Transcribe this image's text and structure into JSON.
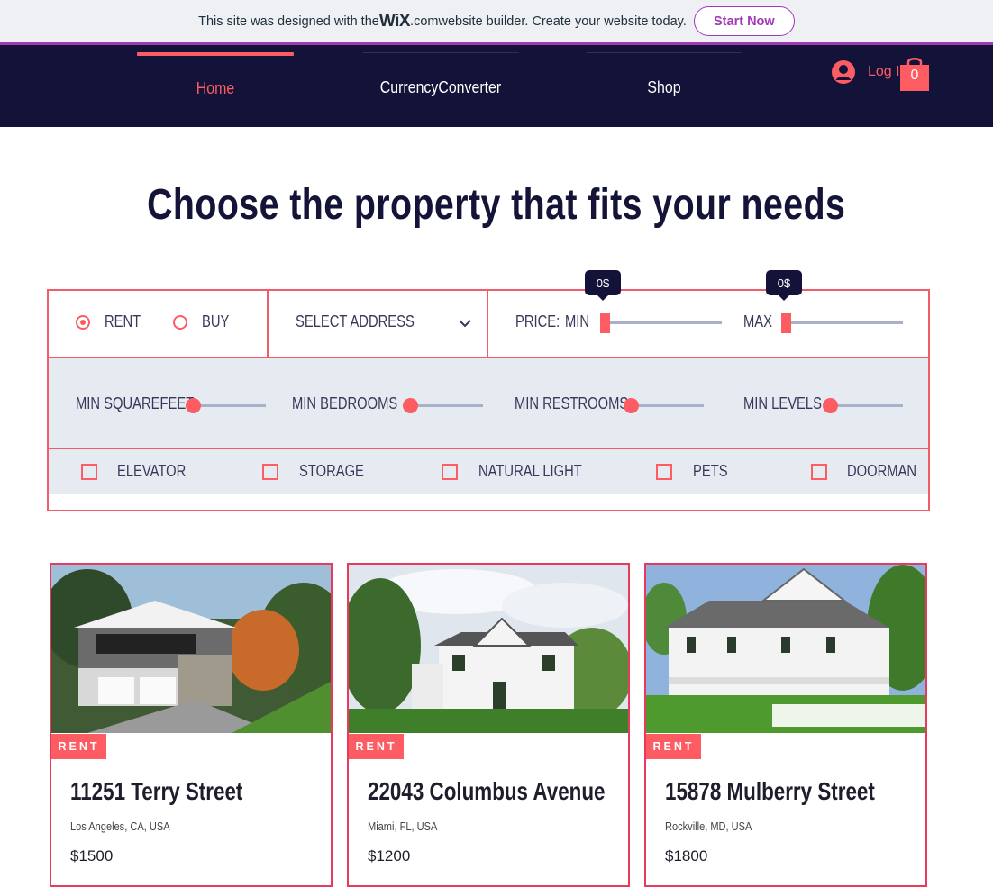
{
  "banner": {
    "text_before": "This site was designed with the ",
    "brand": "WiX",
    "brand_suffix": ".com",
    "text_after": " website builder. Create your website today.",
    "cta": "Start Now"
  },
  "nav": {
    "tabs": [
      "Home",
      "CurrencyConverter",
      "Shop"
    ],
    "active_tab": "Home",
    "login_label": "Log In",
    "cart_count": "0"
  },
  "heading": "Choose the property that fits your needs",
  "filters": {
    "rent_label": "RENT",
    "buy_label": "BUY",
    "selected_mode": "RENT",
    "address_placeholder": "SELECT ADDRESS",
    "price_label": "PRICE:",
    "min_label": "MIN",
    "max_label": "MAX",
    "min_value": "0$",
    "max_value": "0$",
    "sliders": [
      "MIN SQUAREFEET",
      "MIN BEDROOMS",
      "MIN RESTROOMS",
      "MIN LEVELS"
    ],
    "amenities": [
      "ELEVATOR",
      "STORAGE",
      "NATURAL LIGHT",
      "PETS",
      "DOORMAN"
    ]
  },
  "listings": [
    {
      "badge": "RENT",
      "address": "11251 Terry Street",
      "city": "Los Angeles, CA, USA",
      "price": "$1500"
    },
    {
      "badge": "RENT",
      "address": "22043 Columbus Avenue",
      "city": "Miami, FL, USA",
      "price": "$1200"
    },
    {
      "badge": "RENT",
      "address": "15878 Mulberry Street",
      "city": "Rockville, MD, USA",
      "price": "$1800"
    }
  ],
  "colors": {
    "accent": "#fe5c63",
    "nav_bg": "#13133a",
    "wix_purple": "#a03ab5",
    "panel_bg": "#e6ebf2"
  }
}
